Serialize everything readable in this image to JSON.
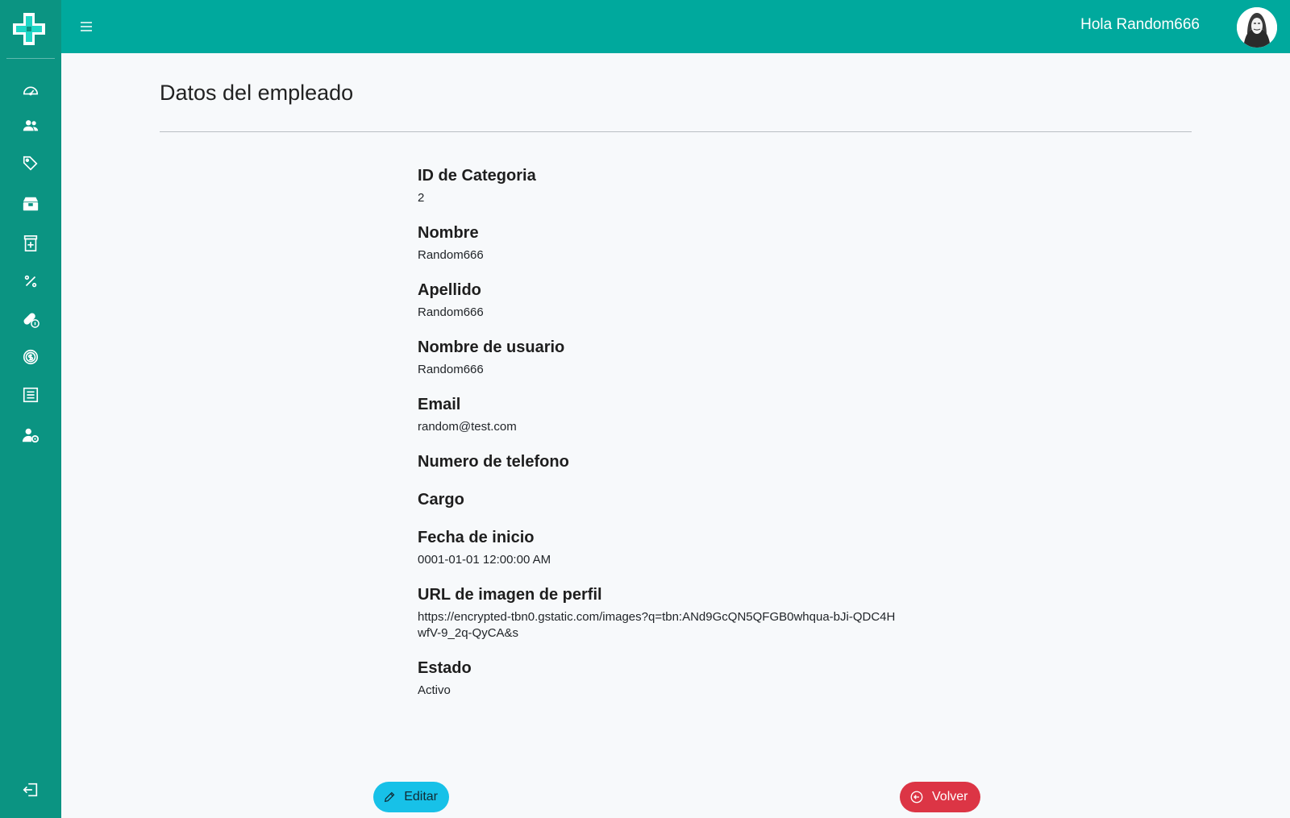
{
  "header": {
    "greeting": "Hola Random666"
  },
  "sidebar": {
    "items": [
      {
        "icon": "dashboard-gauge-icon"
      },
      {
        "icon": "users-icon"
      },
      {
        "icon": "tags-icon"
      },
      {
        "icon": "inventory-box-icon"
      },
      {
        "icon": "medicine-bottle-icon"
      },
      {
        "icon": "percent-icon"
      },
      {
        "icon": "pills-info-icon"
      },
      {
        "icon": "dollar-coin-icon"
      },
      {
        "icon": "invoice-list-icon"
      },
      {
        "icon": "user-settings-icon"
      }
    ],
    "logout_icon": "logout-icon"
  },
  "page": {
    "title": "Datos del empleado"
  },
  "fields": [
    {
      "label": "ID de Categoria",
      "value": "2"
    },
    {
      "label": "Nombre",
      "value": "Random666"
    },
    {
      "label": "Apellido",
      "value": "Random666"
    },
    {
      "label": "Nombre de usuario",
      "value": "Random666"
    },
    {
      "label": "Email",
      "value": "random@test.com"
    },
    {
      "label": "Numero de telefono",
      "value": ""
    },
    {
      "label": "Cargo",
      "value": ""
    },
    {
      "label": "Fecha de inicio",
      "value": "0001-01-01 12:00:00 AM"
    },
    {
      "label": "URL de imagen de perfil",
      "value": "https://encrypted-tbn0.gstatic.com/images?q=tbn:ANd9GcQN5QFGB0whqua-bJi-QDC4HwfV-9_2q-QyCA&s"
    },
    {
      "label": "Estado",
      "value": "Activo"
    }
  ],
  "buttons": {
    "edit_label": "Editar",
    "back_label": "Volver"
  },
  "colors": {
    "sidebar": "#0b9482",
    "topbar": "#00a99d",
    "edit": "#17c1e8",
    "back": "#dc3545"
  }
}
